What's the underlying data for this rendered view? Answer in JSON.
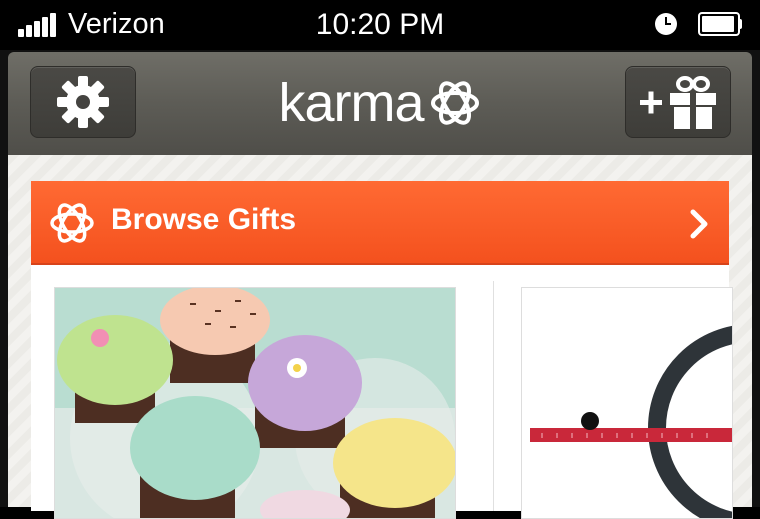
{
  "status_bar": {
    "carrier": "Verizon",
    "time": "10:20 PM",
    "signal_icon": "signal-bars-icon",
    "clock_icon": "alarm-clock-icon",
    "battery_icon": "battery-icon"
  },
  "navbar": {
    "logo_text": "karma",
    "settings_icon": "gear-icon",
    "gift_icon": "add-gift-icon"
  },
  "browse": {
    "label": "Browse Gifts",
    "icon": "karma-flower-icon",
    "chevron_icon": "chevron-right-icon"
  },
  "gifts": [
    {
      "image": "cupcakes-image"
    },
    {
      "image": "ruler-frame-image"
    }
  ],
  "colors": {
    "nav": "#5d5c56",
    "accent": "#f4511e",
    "status_bar": "#000000"
  }
}
